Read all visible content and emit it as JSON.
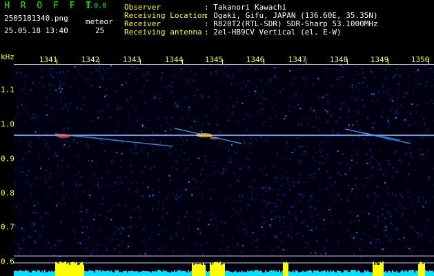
{
  "app": {
    "title": "H R O F F T",
    "version": "1.0.0"
  },
  "file": {
    "name": "2505181340.png",
    "datetime": "25.05.18 13:40"
  },
  "meteor": {
    "label": "meteor",
    "count": "25"
  },
  "info": [
    {
      "key": "Observer",
      "value": ": Takanori Kawachi"
    },
    {
      "key": "Receiving Location",
      "value": ": Ogaki, Gifu, JAPAN (136.60E, 35.35N)"
    },
    {
      "key": "Receiver",
      "value": ": R820T2(RTL-SDR) SDR-Sharp 53.1000MHz"
    },
    {
      "key": "Receiving antenna",
      "value": ": 2el-HB9CV Vertical (el. E-W)"
    }
  ],
  "axis": {
    "unit": "kHz",
    "x_ticks": [
      "1341",
      "1342",
      "1343",
      "1344",
      "1345",
      "1346",
      "1347",
      "1348",
      "1349",
      "1350"
    ],
    "y_ticks": [
      "1.1",
      "1.0",
      "0.9",
      "0.8",
      "0.7",
      "0.6"
    ]
  },
  "colors": {
    "axis": "#ffff00",
    "title": "#00ff00",
    "background": "#000010",
    "noise": "#1c2aa0",
    "signal": "#ffffff",
    "meter": "#00e0ff",
    "meter_peak": "#ffff00"
  }
}
